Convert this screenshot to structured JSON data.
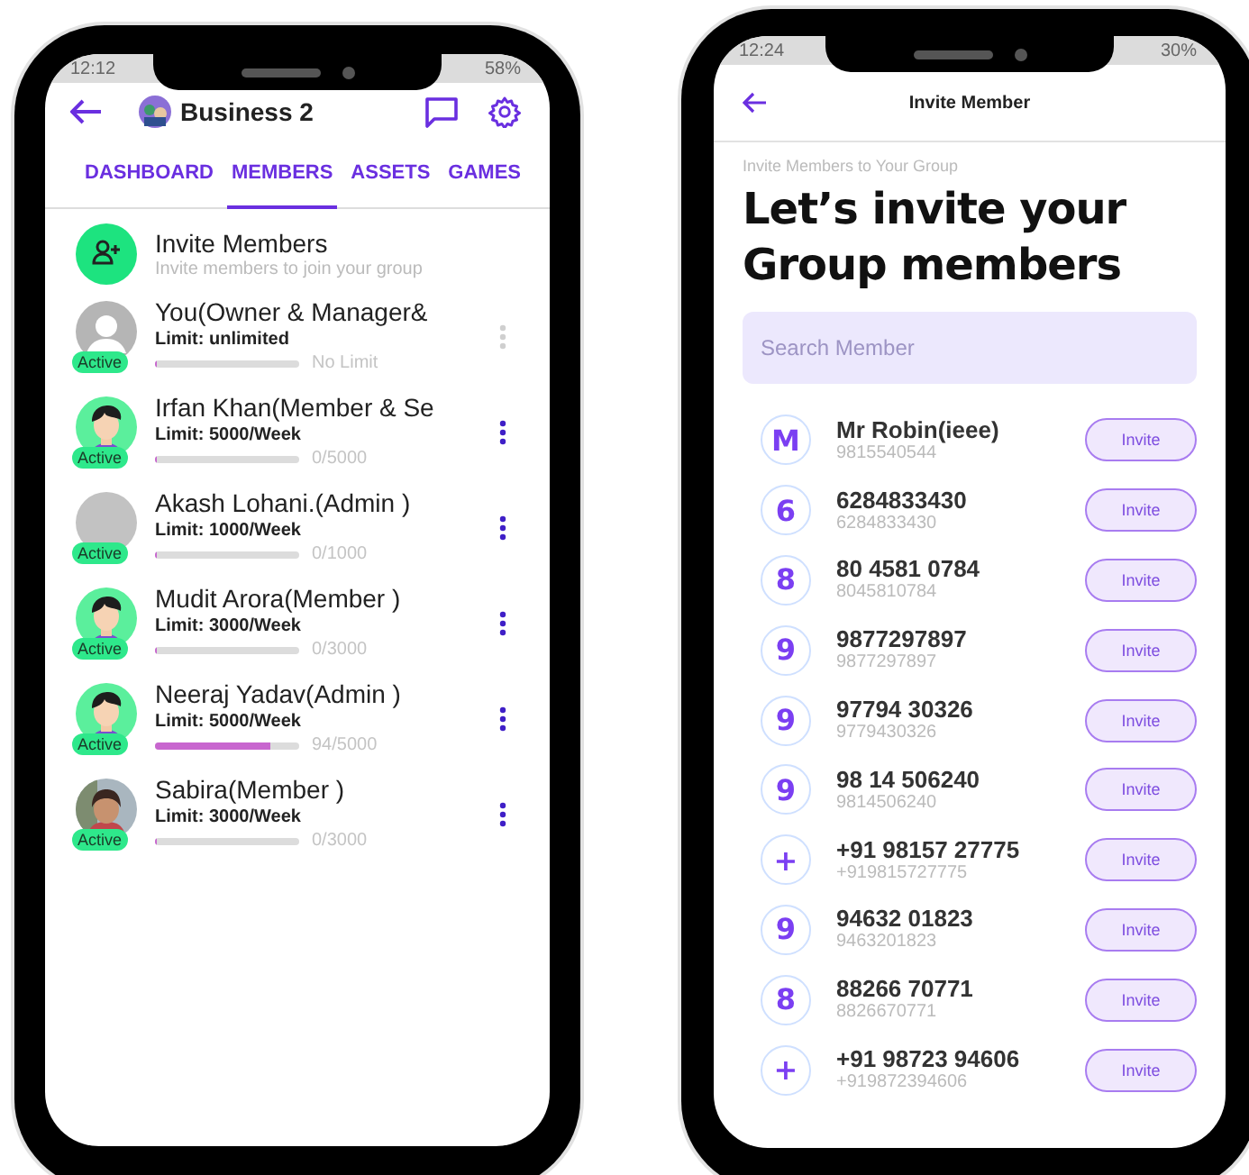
{
  "members_screen": {
    "status_bar": {
      "time": "12:12",
      "battery": "58%"
    },
    "header": {
      "title": "Business 2"
    },
    "tabs": [
      {
        "label": "DASHBOARD",
        "selected": false
      },
      {
        "label": "MEMBERS",
        "selected": true
      },
      {
        "label": "ASSETS",
        "selected": false
      },
      {
        "label": "GAMES",
        "selected": false
      }
    ],
    "invite": {
      "title": "Invite Members",
      "subtitle": "Invite members to join your group"
    },
    "members": [
      {
        "name": "You(Owner & Manager&",
        "limit": "Limit: unlimited",
        "reading": "No Limit",
        "level": 0,
        "status": "Active",
        "avatar": {
          "kind": "placeholder"
        },
        "menu_enabled": false
      },
      {
        "name": "Irfan Khan(Member & Se",
        "limit": "Limit: 5000/Week",
        "reading": "0/5000",
        "level": 0,
        "status": "Active",
        "avatar": {
          "kind": "cartoon"
        },
        "menu_enabled": true
      },
      {
        "name": "Akash Lohani.(Admin )",
        "limit": "Limit: 1000/Week",
        "reading": "0/1000",
        "level": 0,
        "status": "Active",
        "avatar": {
          "kind": "blank"
        },
        "menu_enabled": true
      },
      {
        "name": "Mudit Arora(Member )",
        "limit": "Limit: 3000/Week",
        "reading": "0/3000",
        "level": 0,
        "status": "Active",
        "avatar": {
          "kind": "cartoon"
        },
        "menu_enabled": true
      },
      {
        "name": "Neeraj Yadav(Admin )",
        "limit": "Limit: 5000/Week",
        "reading": "94/5000",
        "level": 0.8,
        "status": "Active",
        "avatar": {
          "kind": "cartoon"
        },
        "menu_enabled": true
      },
      {
        "name": "Sabira(Member )",
        "limit": "Limit: 3000/Week",
        "reading": "0/3000",
        "level": 0,
        "status": "Active",
        "menu_enabled": true
      }
    ]
  },
  "invite_screen": {
    "status_bar": {
      "time": "12:24",
      "battery": "30%"
    },
    "title": "Invite Member",
    "eyebrow": "Invite Members to Your Group",
    "heading": "Let’s invite your Group members",
    "search": {
      "placeholder": "Search Member"
    },
    "contacts": [
      {
        "initial": "M",
        "name": "Mr Robin(ieee)",
        "number": "9815540544",
        "button": "Invite"
      },
      {
        "initial": "6",
        "name": "6284833430",
        "number": "6284833430",
        "button": "Invite"
      },
      {
        "initial": "8",
        "name": "80 4581 0784",
        "number": "8045810784",
        "button": "Invite"
      },
      {
        "initial": "9",
        "name": "9877297897",
        "number": "9877297897",
        "button": "Invite"
      },
      {
        "initial": "9",
        "name": "97794 30326",
        "number": "9779430326",
        "button": "Invite"
      },
      {
        "initial": "9",
        "name": "98 14 506240",
        "number": "9814506240",
        "button": "Invite"
      },
      {
        "initial": "+",
        "name": "+91 98157 27775",
        "number": "+919815727775",
        "button": "Invite"
      },
      {
        "initial": "9",
        "name": "94632 01823",
        "number": "9463201823",
        "button": "Invite"
      },
      {
        "initial": "8",
        "name": "88266 70771",
        "number": "8826670771",
        "button": "Invite"
      },
      {
        "initial": "+",
        "name": "+91 98723 94606",
        "number": "+919872394606",
        "button": "Invite"
      }
    ]
  }
}
